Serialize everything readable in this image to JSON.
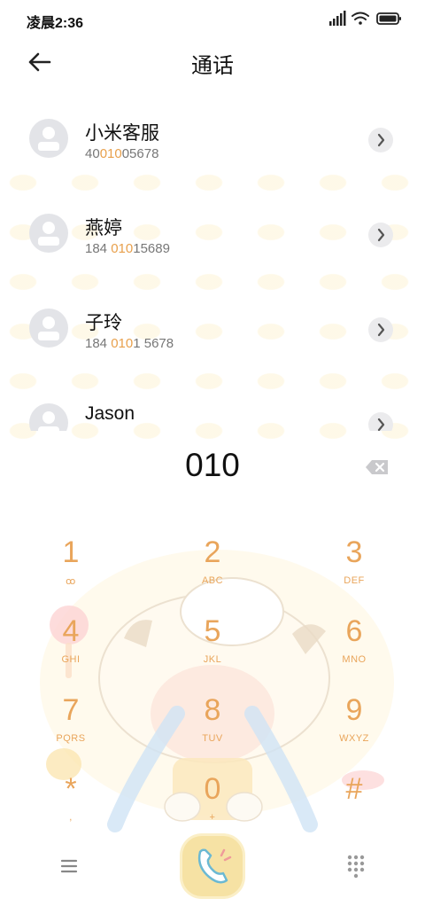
{
  "status_bar": {
    "time": "凌晨2:36"
  },
  "header": {
    "title": "通话"
  },
  "contacts": [
    {
      "name": "小米客服",
      "number_parts": [
        "40",
        "010",
        "05678"
      ]
    },
    {
      "name": "燕婷",
      "number_parts": [
        "184 ",
        "010",
        "15689"
      ]
    },
    {
      "name": "子玲",
      "number_parts": [
        "184 ",
        "010",
        "1 5678"
      ]
    },
    {
      "name": "Jason",
      "number_parts": [
        "",
        "",
        ""
      ]
    }
  ],
  "dialer": {
    "input": "010",
    "keys": [
      {
        "digit": "1",
        "letters": "ꝏ"
      },
      {
        "digit": "2",
        "letters": "ABC"
      },
      {
        "digit": "3",
        "letters": "DEF"
      },
      {
        "digit": "4",
        "letters": "GHI"
      },
      {
        "digit": "5",
        "letters": "JKL"
      },
      {
        "digit": "6",
        "letters": "MNO"
      },
      {
        "digit": "7",
        "letters": "PQRS"
      },
      {
        "digit": "8",
        "letters": "TUV"
      },
      {
        "digit": "9",
        "letters": "WXYZ"
      },
      {
        "digit": "*",
        "letters": ","
      },
      {
        "digit": "0",
        "letters": "+"
      },
      {
        "digit": "#",
        "letters": ""
      }
    ]
  },
  "colors": {
    "accent": "#e8a04c",
    "key_text": "#e9a55b",
    "call_button": "#f6e2a4"
  },
  "icons": {
    "back": "arrow-left-icon",
    "chevron": "chevron-right-icon",
    "delete": "backspace-icon",
    "menu": "menu-icon",
    "call": "phone-icon",
    "keypad": "keypad-grid-icon"
  }
}
